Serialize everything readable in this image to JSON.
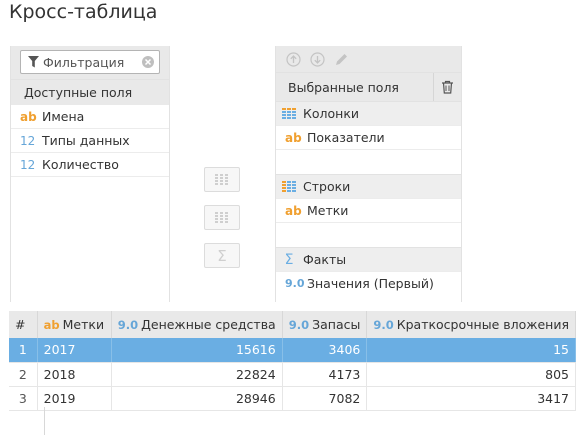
{
  "title": "Кросс-таблица",
  "filter": {
    "placeholder": "Фильтрация"
  },
  "available": {
    "header": "Доступные поля",
    "fields": [
      {
        "type": "ab",
        "label": "Имена"
      },
      {
        "type": "12",
        "label": "Типы данных"
      },
      {
        "type": "12",
        "label": "Количество"
      }
    ]
  },
  "selected": {
    "header": "Выбранные поля",
    "columns": {
      "label": "Колонки",
      "fields": [
        {
          "type": "ab",
          "label": "Показатели"
        }
      ]
    },
    "rows": {
      "label": "Строки",
      "fields": [
        {
          "type": "ab",
          "label": "Метки"
        }
      ]
    },
    "facts": {
      "label": "Факты",
      "fields": [
        {
          "type": "9.0",
          "label": "Значения (Первый)"
        }
      ]
    }
  },
  "table": {
    "columns": [
      {
        "icon": "",
        "label": "#"
      },
      {
        "icon": "ab",
        "label": "Метки"
      },
      {
        "icon": "9.0",
        "label": "Денежные средства"
      },
      {
        "icon": "9.0",
        "label": "Запасы"
      },
      {
        "icon": "9.0",
        "label": "Краткосрочные вложения"
      }
    ],
    "rows": [
      {
        "n": "1",
        "label": "2017",
        "cash": "15616",
        "stock": "3406",
        "short": "15",
        "selected": true
      },
      {
        "n": "2",
        "label": "2018",
        "cash": "22824",
        "stock": "4173",
        "short": "805",
        "selected": false
      },
      {
        "n": "3",
        "label": "2019",
        "cash": "28946",
        "stock": "7082",
        "short": "3417",
        "selected": false
      }
    ]
  },
  "colors": {
    "accent": "#6aaee3",
    "ab": "#f0a030",
    "num": "#66a6d8"
  }
}
